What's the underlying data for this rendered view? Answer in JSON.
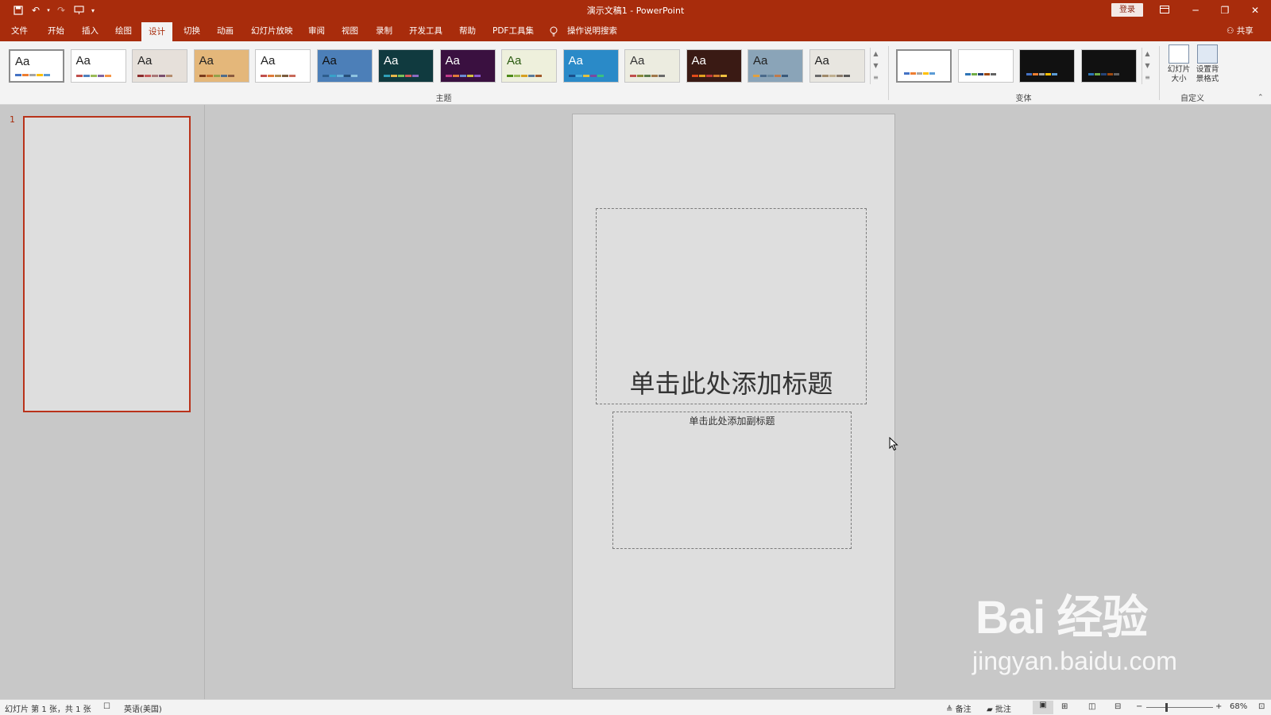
{
  "window": {
    "title": "演示文稿1 - PowerPoint",
    "login_label": "登录",
    "share_label": "共享"
  },
  "tabs": [
    "文件",
    "开始",
    "插入",
    "绘图",
    "设计",
    "切换",
    "动画",
    "幻灯片放映",
    "审阅",
    "视图",
    "录制",
    "开发工具",
    "帮助",
    "PDF工具集"
  ],
  "active_tab": "设计",
  "tell_me": "操作说明搜索",
  "ribbon": {
    "themes_label": "主题",
    "variants_label": "变体",
    "customize_label": "自定义",
    "slide_size_label": "幻灯片大小",
    "format_bg_label": "设置背景格式",
    "theme_aa": "Aa",
    "themes": [
      {
        "bg": "#ffffff",
        "fg": "#222222",
        "dots": [
          "#4472c4",
          "#ed7d31",
          "#a5a5a5",
          "#ffc000",
          "#5b9bd5"
        ]
      },
      {
        "bg": "#ffffff",
        "fg": "#222222",
        "dots": [
          "#c0504d",
          "#4f81bd",
          "#9bbb59",
          "#8064a2",
          "#f79646"
        ]
      },
      {
        "bg": "#e6e0da",
        "fg": "#222222",
        "dots": [
          "#8b2d2d",
          "#c45a5a",
          "#a97878",
          "#7a4f6f",
          "#b48c6e"
        ]
      },
      {
        "bg": "#e4b77a",
        "fg": "#222222",
        "dots": [
          "#7a3b1c",
          "#c46a2a",
          "#92a14a",
          "#4f6d8c",
          "#8a5a3e"
        ]
      },
      {
        "bg": "#ffffff",
        "fg": "#222222",
        "dots": [
          "#c0504d",
          "#e07b39",
          "#b08a50",
          "#7a5c3e",
          "#c96a5a"
        ]
      },
      {
        "bg": "#4c7fb8",
        "fg": "#111111",
        "dots": [
          "#2e5d8c",
          "#38a1c9",
          "#6ab0d8",
          "#264f78",
          "#8ec3e0"
        ]
      },
      {
        "bg": "#103a3f",
        "fg": "#ffffff",
        "dots": [
          "#2fa0b8",
          "#e6b54a",
          "#7abf5a",
          "#d45a5a",
          "#8a6ac0"
        ]
      },
      {
        "bg": "#3a1040",
        "fg": "#ffffff",
        "dots": [
          "#c03a8a",
          "#e07a3a",
          "#6a8ad0",
          "#d0c040",
          "#8a5ad0"
        ]
      },
      {
        "bg": "#eef0dc",
        "fg": "#2a5a10",
        "dots": [
          "#4e8a1a",
          "#9bbb59",
          "#d6a020",
          "#5a7a9a",
          "#a05a2a"
        ]
      },
      {
        "bg": "#2a8ac8",
        "fg": "#ffffff",
        "dots": [
          "#1a4e8a",
          "#4ab0e0",
          "#e0c040",
          "#7a4aa0",
          "#3ac080"
        ]
      },
      {
        "bg": "#ecece0",
        "fg": "#333333",
        "dots": [
          "#c0504d",
          "#8a8a3a",
          "#5a7a4a",
          "#a0784a",
          "#6a6a6a"
        ]
      },
      {
        "bg": "#3a1a14",
        "fg": "#ffffff",
        "dots": [
          "#e04a1a",
          "#e0a020",
          "#c03a3a",
          "#d07a2a",
          "#f0c040"
        ]
      },
      {
        "bg": "#8aa4b8",
        "fg": "#222222",
        "dots": [
          "#e0a040",
          "#4a6a8a",
          "#6a8aa0",
          "#c07a4a",
          "#3a5a7a"
        ]
      },
      {
        "bg": "#e8e6e0",
        "fg": "#222222",
        "dots": [
          "#6a6a6a",
          "#a08a6a",
          "#c0b090",
          "#8a7a6a",
          "#5a5a5a"
        ]
      }
    ],
    "variants": [
      {
        "bg": "#ffffff",
        "dots": [
          "#4472c4",
          "#ed7d31",
          "#a5a5a5",
          "#ffc000",
          "#5b9bd5"
        ]
      },
      {
        "bg": "#ffffff",
        "dots": [
          "#2e75b6",
          "#70ad47",
          "#264478",
          "#9e480e",
          "#636363"
        ]
      },
      {
        "bg": "#111111",
        "dots": [
          "#4472c4",
          "#ed7d31",
          "#a5a5a5",
          "#ffc000",
          "#5b9bd5"
        ]
      },
      {
        "bg": "#111111",
        "dots": [
          "#2e75b6",
          "#70ad47",
          "#264478",
          "#9e480e",
          "#636363"
        ]
      }
    ]
  },
  "slide_pane": {
    "slide_number": "1"
  },
  "slide": {
    "title_placeholder": "单击此处添加标题",
    "subtitle_placeholder": "单击此处添加副标题"
  },
  "status": {
    "slide_info": "幻灯片 第 1 张，共 1 张",
    "language": "英语(美国)",
    "notes_label": "备注",
    "comments_label": "批注",
    "zoom": "68%"
  },
  "watermark": {
    "main": "Bai 经验",
    "sub": "jingyan.baidu.com"
  },
  "colors": {
    "accent": "#a82c0c",
    "ribbon_bg": "#f3f3f3",
    "workspace": "#c8c8c8",
    "slide_bg": "#dedede"
  }
}
